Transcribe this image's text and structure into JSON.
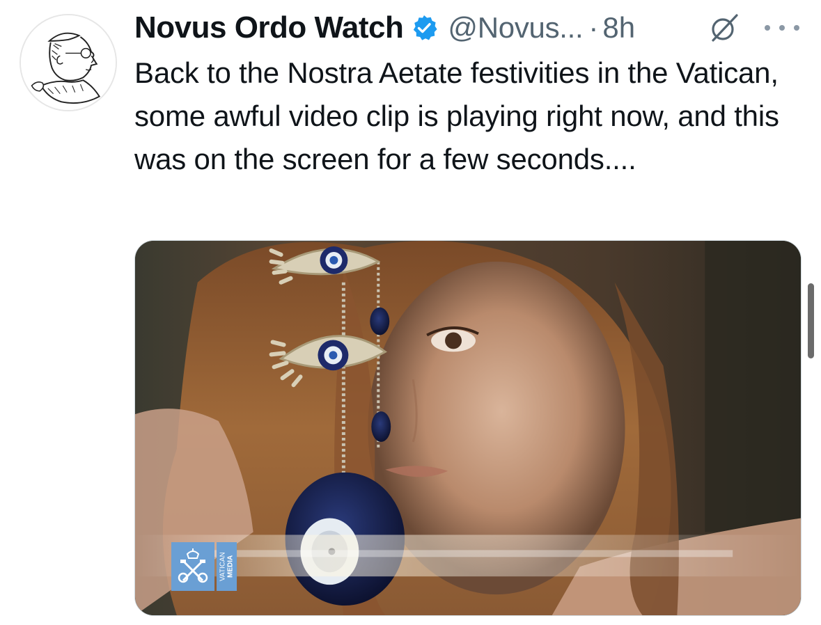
{
  "tweet": {
    "display_name": "Novus Ordo Watch",
    "handle": "@Novus...",
    "separator": "·",
    "timestamp": "8h",
    "text": "Back to the Nostra Aetate festivities in the Vatican, some awful video clip is playing right now, and this was on the screen for a few seconds....",
    "avatar_icon": "pope-portrait-sketch",
    "verified_icon": "verified-badge-icon",
    "verified_color": "#1d9bf0",
    "actions": {
      "grok_icon": "grok-icon",
      "more_icon": "more-options-icon"
    }
  },
  "media": {
    "watermark": {
      "line_1": "VATICAN",
      "line_2": "MEDIA",
      "color": "#6a9fd4"
    }
  },
  "colors": {
    "text_primary": "#0f1419",
    "text_secondary": "#536471"
  }
}
